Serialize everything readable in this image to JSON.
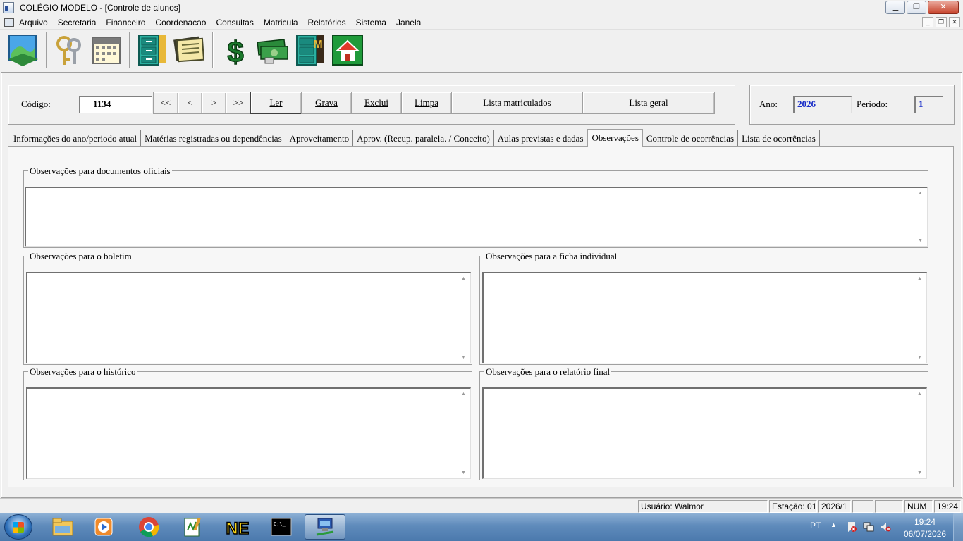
{
  "window": {
    "title": "COLÉGIO MODELO - [Controle de alunos]",
    "minimize": "▁",
    "maximize": "❐",
    "close": "✕"
  },
  "menu": [
    "Arquivo",
    "Secretaria",
    "Financeiro",
    "Coordenacao",
    "Consultas",
    "Matricula",
    "Relatórios",
    "Sistema",
    "Janela"
  ],
  "mdi": {
    "minimize": "_",
    "restore": "❐",
    "close": "✕"
  },
  "toolbar_icons": [
    "map-icon",
    "keys-icon",
    "calendar-icon",
    "file-cabinet-icon",
    "documents-icon",
    "dollar-icon",
    "money-icon",
    "file-cabinet-m-icon",
    "home-icon"
  ],
  "form": {
    "codigo_label": "Código:",
    "codigo_value": "1134",
    "nav_first": "<<",
    "nav_prev": "<",
    "nav_next": ">",
    "nav_last": ">>",
    "btn_ler": "Ler",
    "btn_grava": "Grava",
    "btn_exclui": "Exclui",
    "btn_limpa": "Limpa",
    "btn_lista_matriculados": "Lista matriculados",
    "btn_lista_geral": "Lista geral",
    "ano_label": "Ano:",
    "ano_value": "2026",
    "periodo_label": "Periodo:",
    "periodo_value": "1"
  },
  "tabs": [
    "Informações do ano/periodo atual",
    "Matérias registradas ou dependências",
    "Aproveitamento",
    "Aprov. (Recup. paralela. / Conceito)",
    "Aulas previstas e dadas",
    "Observações",
    "Controle de ocorrências",
    "Lista de ocorrências"
  ],
  "active_tab": "Observações",
  "groups": {
    "documentos": "Observações para documentos oficiais",
    "boletim": "Observações para o boletim",
    "ficha": "Observações para a ficha individual",
    "historico": "Observações para o histórico",
    "relatorio": "Observações para o relatório final"
  },
  "status": {
    "usuario": "Usuário: Walmor",
    "estacao": "Estação: 01",
    "periodo": "2026/1",
    "num": "NUM",
    "hora": "19:24"
  },
  "taskbar": {
    "apps": [
      "explorer-icon",
      "media-player-icon",
      "chrome-icon",
      "notepad-icon",
      "ne-icon",
      "cmd-icon",
      "network-app-icon"
    ],
    "lang": "PT",
    "time": "19:24",
    "date": "06/07/2026"
  },
  "colors": {
    "accent_blue": "#1a2ec8",
    "taskbar": "#5f8bbb"
  }
}
